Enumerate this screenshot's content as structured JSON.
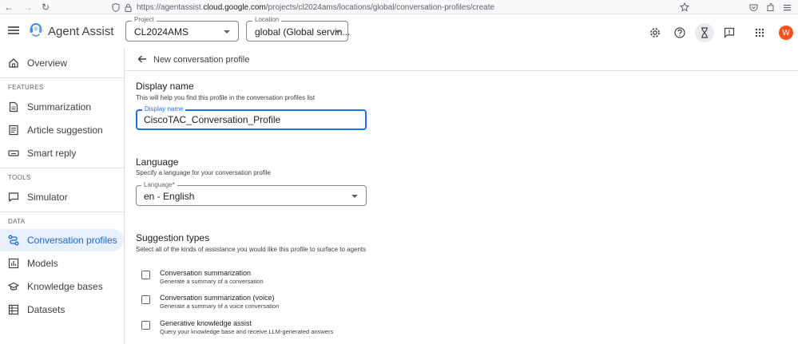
{
  "browser": {
    "url_prefix": "https://agentassist.",
    "url_domain": "cloud.google.com",
    "url_path": "/projects/cl2024ams/locations/global/conversation-profiles/create"
  },
  "header": {
    "app_title": "Agent Assist",
    "project_label": "Project",
    "project_value": "CL2024AMS",
    "location_label": "Location",
    "location_value": "global (Global servin...",
    "avatar_letter": "W",
    "avatar_color": "#f4511e"
  },
  "sidebar": {
    "overview": "Overview",
    "features_heading": "FEATURES",
    "summarization": "Summarization",
    "article_suggestion": "Article suggestion",
    "smart_reply": "Smart reply",
    "tools_heading": "TOOLS",
    "simulator": "Simulator",
    "data_heading": "DATA",
    "conversation_profiles": "Conversation profiles",
    "models": "Models",
    "knowledge_bases": "Knowledge bases",
    "datasets": "Datasets"
  },
  "main": {
    "page_title": "New conversation profile",
    "display_name": {
      "title": "Display name",
      "description": "This will help you find this profile in the conversation profiles list",
      "field_label": "Display name",
      "value": "CiscoTAC_Conversation_Profile"
    },
    "language": {
      "title": "Language",
      "description": "Specify a language for your conversation profile",
      "field_label": "Language*",
      "value": "en - English"
    },
    "suggestion_types": {
      "title": "Suggestion types",
      "description": "Select all of the kinds of assistance you would like this profile to surface to agents",
      "items": [
        {
          "title": "Conversation summarization",
          "subtitle": "Generate a summary of a conversation"
        },
        {
          "title": "Conversation summarization (voice)",
          "subtitle": "Generate a summary of a voice conversation"
        },
        {
          "title": "Generative knowledge assist",
          "subtitle": "Query your knowledge base and receive LLM-generated answers"
        }
      ]
    }
  },
  "colors": {
    "accent": "#1a73e8",
    "selected_bg": "#e8f0fe",
    "selected_text": "#1967d2"
  }
}
